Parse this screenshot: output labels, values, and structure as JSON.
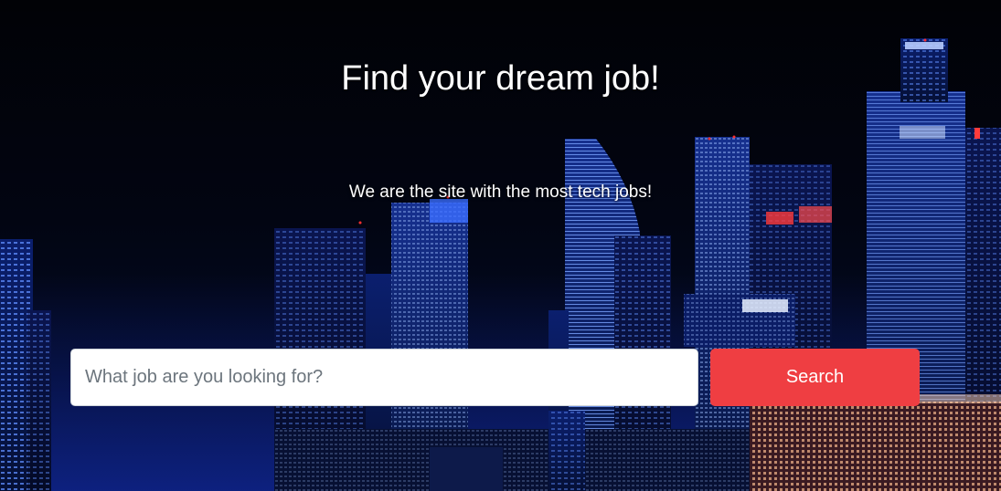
{
  "hero": {
    "title": "Find your dream job!",
    "subtitle": "We are the site with the most tech jobs!",
    "background_image": "night-city-skyline"
  },
  "search": {
    "placeholder": "What job are you looking for?",
    "value": "",
    "button_label": "Search"
  },
  "colors": {
    "button_background": "#ef3e42",
    "text": "#ffffff",
    "background": "#02030a",
    "accent_blue": "#2f6bff"
  }
}
